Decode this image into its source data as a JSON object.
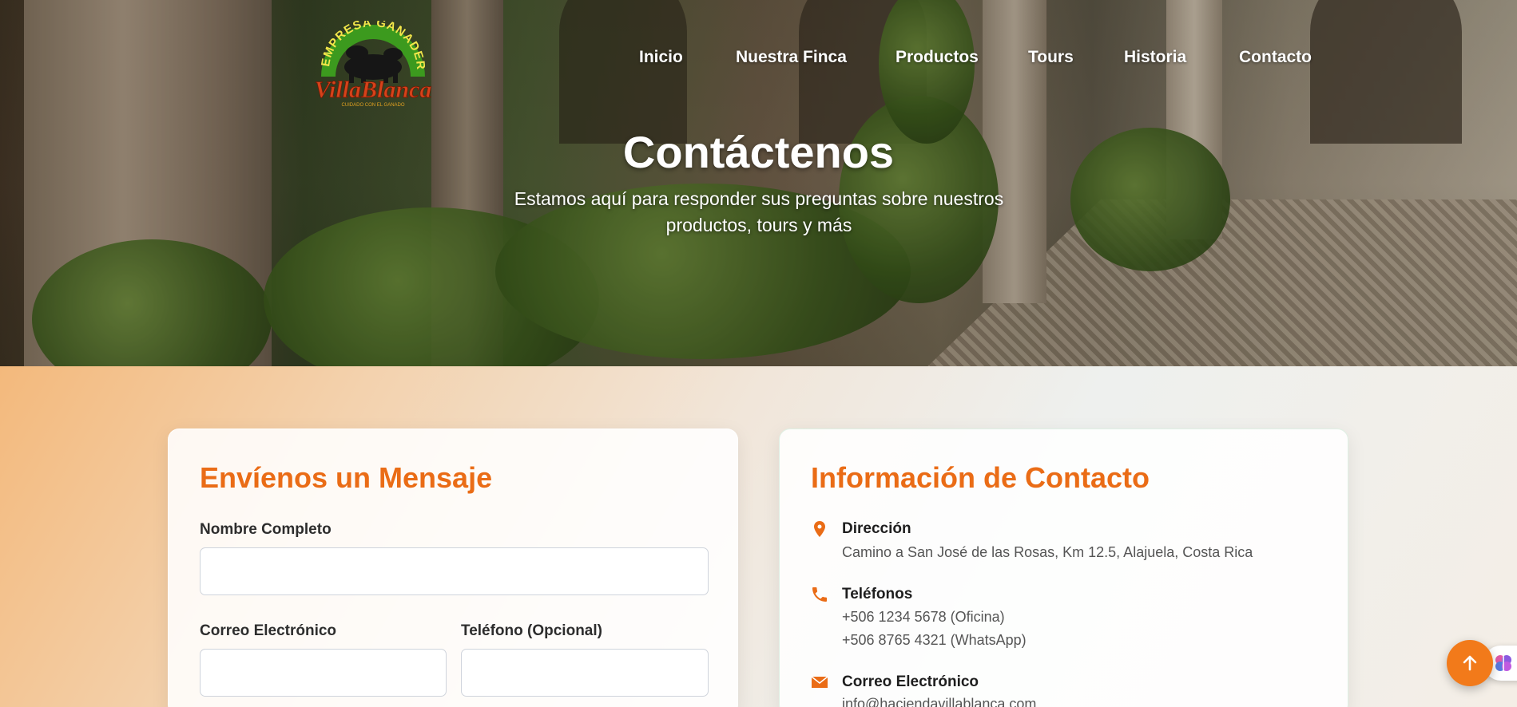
{
  "logo": {
    "arc_text": "EMPRESA GANADERA",
    "brand": "VillaBlanca",
    "tagline": "CUIDADO CON EL GANADO"
  },
  "nav": {
    "items": [
      {
        "label": "Inicio"
      },
      {
        "label": "Nuestra Finca"
      },
      {
        "label": "Productos"
      },
      {
        "label": "Tours"
      },
      {
        "label": "Historia"
      },
      {
        "label": "Contacto"
      }
    ]
  },
  "hero": {
    "title": "Contáctenos",
    "subtitle": "Estamos aquí para responder sus preguntas sobre nuestros productos, tours y más"
  },
  "form": {
    "title": "Envíenos un Mensaje",
    "name_label": "Nombre Completo",
    "email_label": "Correo Electrónico",
    "phone_label": "Teléfono (Opcional)",
    "name_value": "",
    "email_value": "",
    "phone_value": ""
  },
  "info": {
    "title": "Información de Contacto",
    "address_title": "Dirección",
    "address": "Camino a San José de las Rosas, Km 12.5, Alajuela, Costa Rica",
    "phones_title": "Teléfonos",
    "phone1": "+506 1234 5678 (Oficina)",
    "phone2": "+506 8765 4321 (WhatsApp)",
    "email_title": "Correo Electrónico",
    "email": "info@haciendavillablanca.com"
  },
  "icons": {
    "address": "map-pin-icon",
    "phone": "phone-icon",
    "email": "envelope-icon",
    "scroll_top": "arrow-up-icon",
    "assistant": "brain-icon"
  },
  "colors": {
    "accent": "#ea6c16",
    "button": "#f27a1a"
  }
}
